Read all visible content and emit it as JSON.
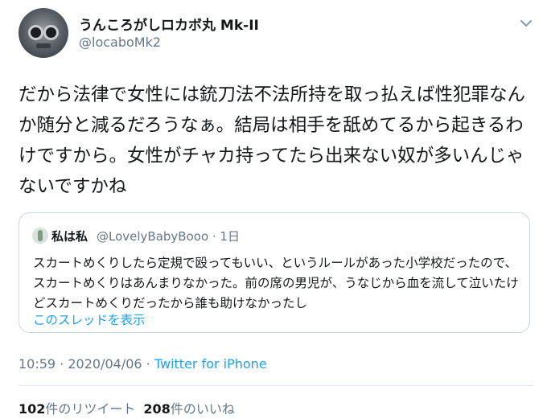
{
  "user": {
    "display_name": "うんころがしロカボ丸 Mk-II",
    "handle": "@locaboMk2"
  },
  "tweet": {
    "text": "だから法律で女性には銃刀法不法所持を取っ払えば性犯罪なんか随分と減るだろうなぁ。結局は相手を舐めてるから起きるわけですから。女性がチャカ持ってたら出来ない奴が多いんじゃないですかね",
    "time": "10:59",
    "date": "2020/04/06",
    "separator": " · ",
    "source": "Twitter for iPhone"
  },
  "quote": {
    "display_name": "私は私",
    "handle_and_time": "@LovelyBabyBooo · 1日",
    "text": "スカートめくりしたら定規で殴ってもいい、というルールがあった小学校だったので、スカートめくりはあんまりなかった。前の席の男児が、うなじから血を流して泣いたけどスカートめくりだったから誰も助けなかったし",
    "show_thread": "このスレッドを表示"
  },
  "stats": {
    "retweets_count": "102",
    "retweets_label": "件のリツイート",
    "likes_count": "208",
    "likes_label": "件のいいね"
  },
  "colors": {
    "accent": "#1da1f2",
    "secondary_text": "#657786",
    "border": "#ccd6dd"
  }
}
